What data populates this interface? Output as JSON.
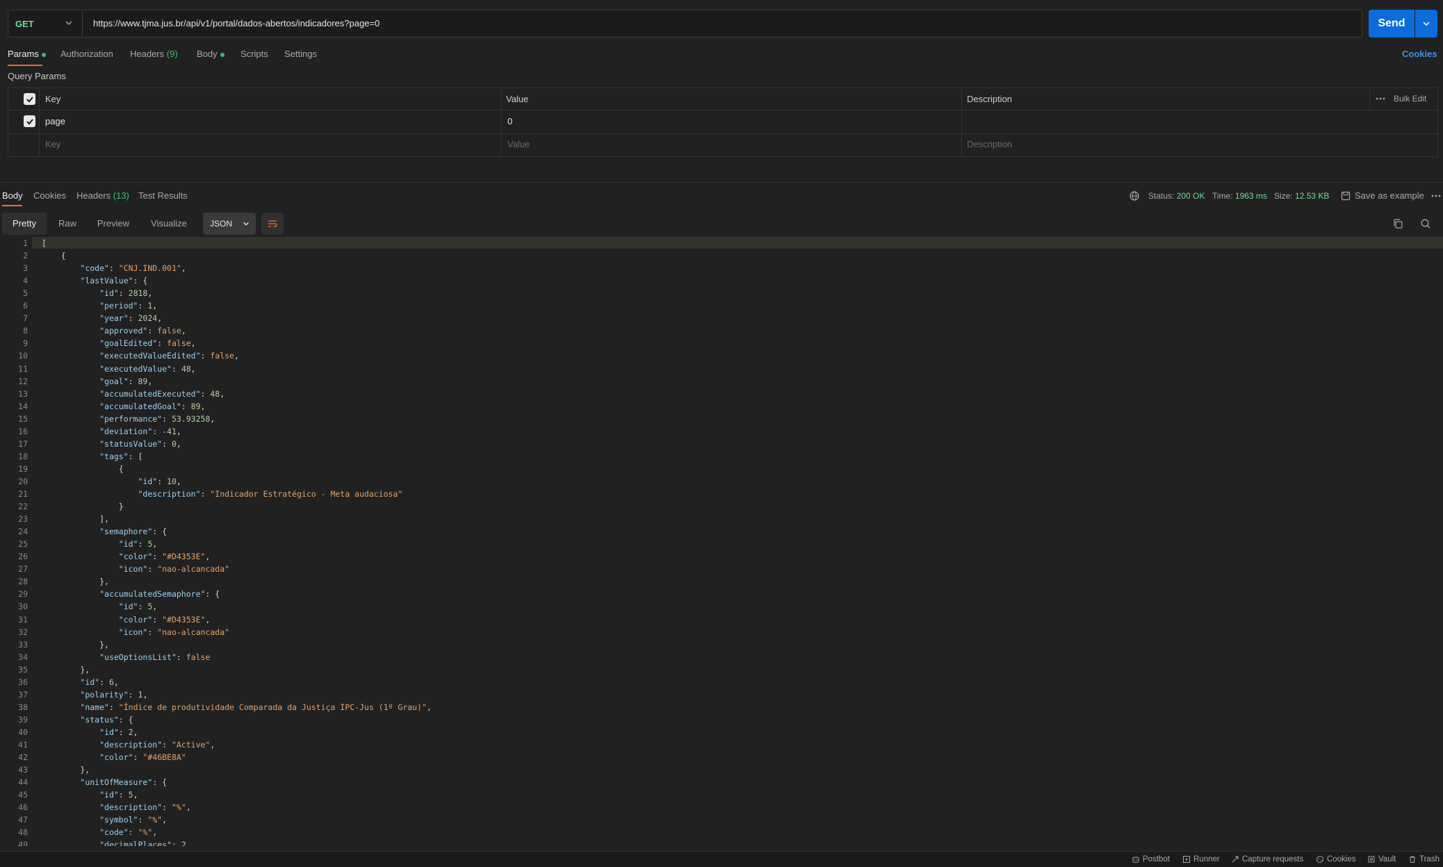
{
  "request": {
    "method": "GET",
    "url": "https://www.tjma.jus.br/api/v1/portal/dados-abertos/indicadores?page=0",
    "send_label": "Send"
  },
  "request_tabs": {
    "params": "Params",
    "authorization": "Authorization",
    "headers": "Headers",
    "headers_count": "(9)",
    "body": "Body",
    "scripts": "Scripts",
    "settings": "Settings"
  },
  "cookies_link": "Cookies",
  "query_params": {
    "title": "Query Params",
    "headers": {
      "key": "Key",
      "value": "Value",
      "description": "Description",
      "bulk_edit": "Bulk Edit"
    },
    "rows": [
      {
        "key": "page",
        "value": "0",
        "description": ""
      }
    ],
    "placeholders": {
      "key": "Key",
      "value": "Value",
      "description": "Description"
    }
  },
  "response_tabs": {
    "body": "Body",
    "cookies": "Cookies",
    "headers": "Headers",
    "headers_count": "(13)",
    "test_results": "Test Results"
  },
  "response_meta": {
    "status_label": "Status:",
    "status_value": "200 OK",
    "time_label": "Time:",
    "time_value": "1963 ms",
    "size_label": "Size:",
    "size_value": "12.53 KB",
    "save_example": "Save as example"
  },
  "view_tabs": {
    "pretty": "Pretty",
    "raw": "Raw",
    "preview": "Preview",
    "visualize": "Visualize",
    "format": "JSON"
  },
  "code_lines": [
    "[",
    "    {",
    "        \"code\": \"CNJ.IND.001\",",
    "        \"lastValue\": {",
    "            \"id\": 2818,",
    "            \"period\": 1,",
    "            \"year\": 2024,",
    "            \"approved\": false,",
    "            \"goalEdited\": false,",
    "            \"executedValueEdited\": false,",
    "            \"executedValue\": 48,",
    "            \"goal\": 89,",
    "            \"accumulatedExecuted\": 48,",
    "            \"accumulatedGoal\": 89,",
    "            \"performance\": 53.93258,",
    "            \"deviation\": -41,",
    "            \"statusValue\": 0,",
    "            \"tags\": [",
    "                {",
    "                    \"id\": 10,",
    "                    \"description\": \"Indicador Estratégico - Meta audaciosa\"",
    "                }",
    "            ],",
    "            \"semaphore\": {",
    "                \"id\": 5,",
    "                \"color\": \"#D4353E\",",
    "                \"icon\": \"nao-alcancada\"",
    "            },",
    "            \"accumulatedSemaphore\": {",
    "                \"id\": 5,",
    "                \"color\": \"#D4353E\",",
    "                \"icon\": \"nao-alcancada\"",
    "            },",
    "            \"useOptionsList\": false",
    "        },",
    "        \"id\": 6,",
    "        \"polarity\": 1,",
    "        \"name\": \"Índice de produtividade Comparada da Justiça IPC-Jus (1º Grau)\",",
    "        \"status\": {",
    "            \"id\": 2,",
    "            \"description\": \"Active\",",
    "            \"color\": \"#46BE8A\"",
    "        },",
    "        \"unitOfMeasure\": {",
    "            \"id\": 5,",
    "            \"description\": \"%\",",
    "            \"symbol\": \"%\",",
    "            \"code\": \"%\",",
    "            \"decimalPlaces\": 2"
  ],
  "footer": {
    "postbot": "Postbot",
    "runner": "Runner",
    "capture": "Capture requests",
    "cookies": "Cookies",
    "vault": "Vault",
    "trash": "Trash"
  },
  "colors": {
    "accent": "#f26b3a",
    "send": "#0c6cd9",
    "success": "#36c26e",
    "link": "#3f8fe6"
  }
}
